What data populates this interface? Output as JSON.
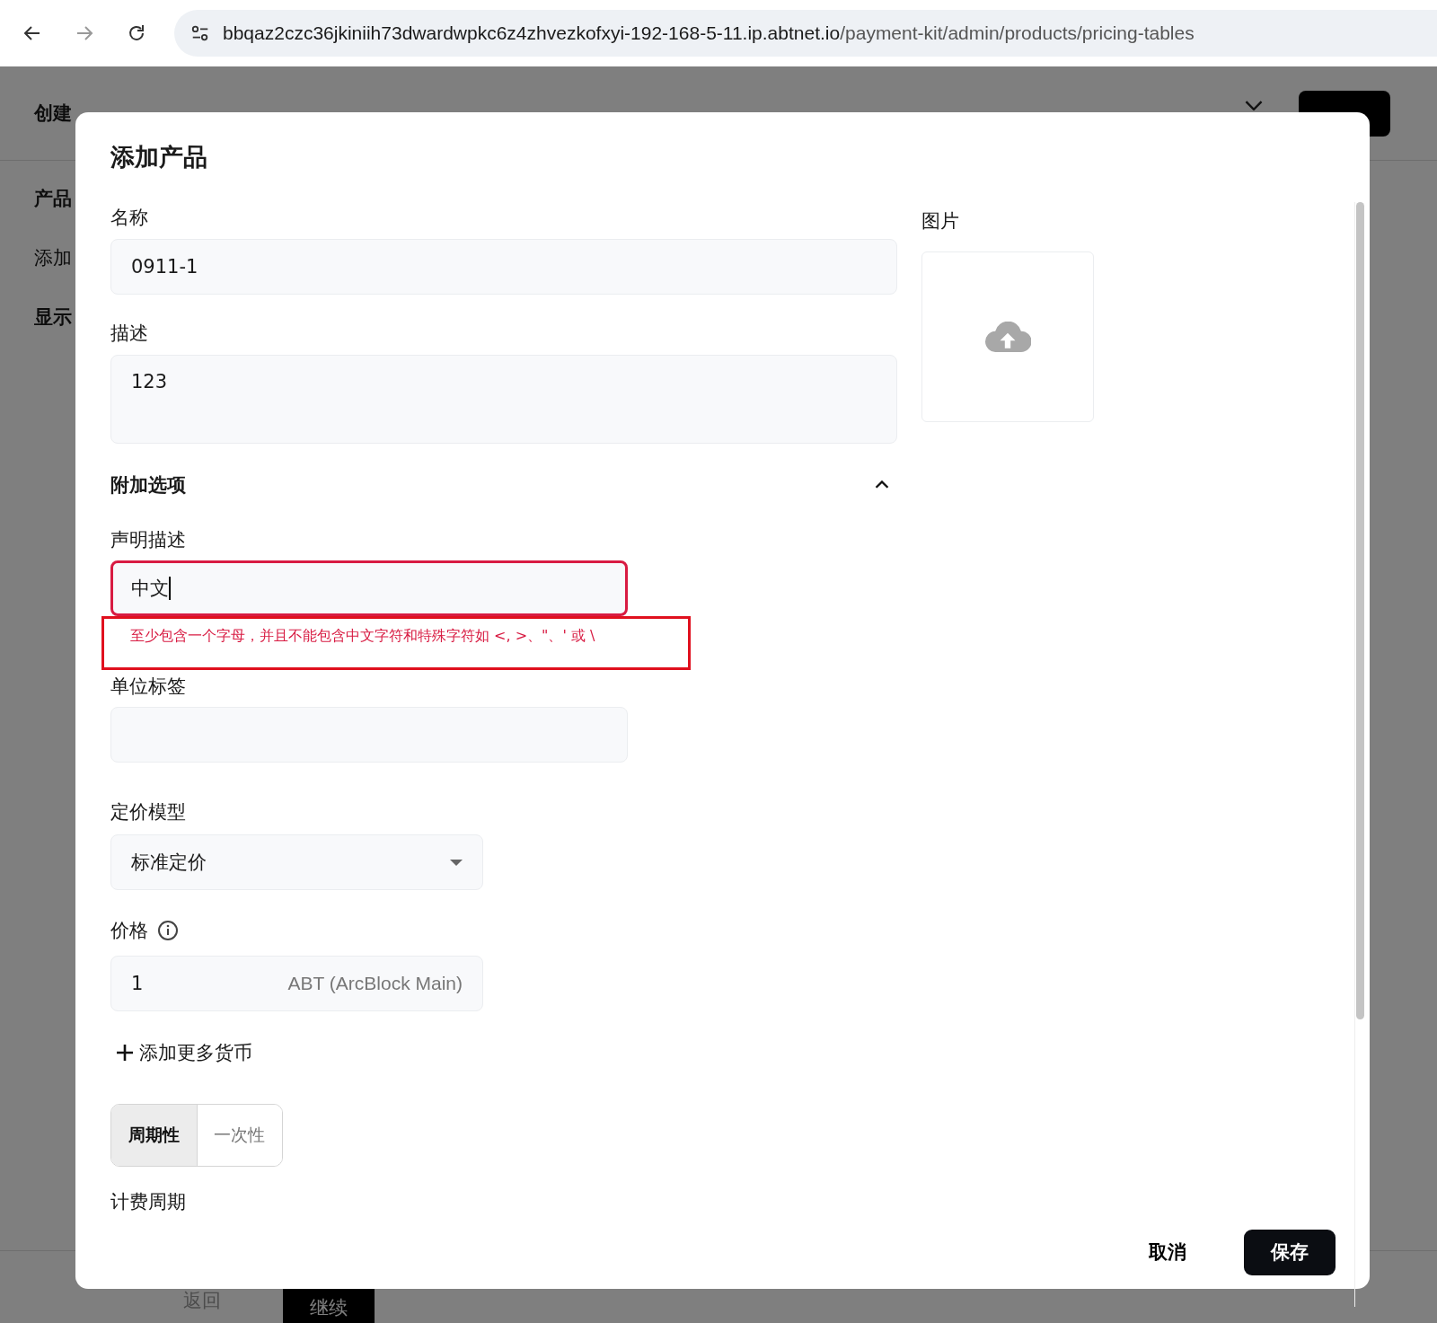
{
  "browser": {
    "url_host": "bbqaz2czc36jkiniih73dwardwpkc6z4zhvezkofxyi-192-168-5-11.ip.abtnet.io",
    "url_path": "/payment-kit/admin/products/pricing-tables"
  },
  "page": {
    "title": "创建",
    "sections": [
      "产品",
      "添加",
      "显示"
    ],
    "back_button": "返回",
    "continue_button": "继续"
  },
  "dialog": {
    "title": "添加产品",
    "name": {
      "label": "名称",
      "value": "0911-1"
    },
    "description": {
      "label": "描述",
      "value": "123"
    },
    "image": {
      "label": "图片"
    },
    "extra": {
      "title": "附加选项",
      "expanded": true
    },
    "statement": {
      "label": "声明描述",
      "value": "中文",
      "error": "至少包含一个字母，并且不能包含中文字符和特殊字符如 <, >、\"、' 或 \\"
    },
    "unit_label": {
      "label": "单位标签"
    },
    "pricing_model": {
      "label": "定价模型",
      "value": "标准定价"
    },
    "price": {
      "label": "价格",
      "value": "1",
      "currency": "ABT (ArcBlock Main)"
    },
    "add_currency": "添加更多货币",
    "billing_type": [
      {
        "label": "周期性",
        "selected": true
      },
      {
        "label": "一次性",
        "selected": false
      }
    ],
    "billing_period_label": "计费周期",
    "cancel_button": "取消",
    "save_button": "保存"
  }
}
